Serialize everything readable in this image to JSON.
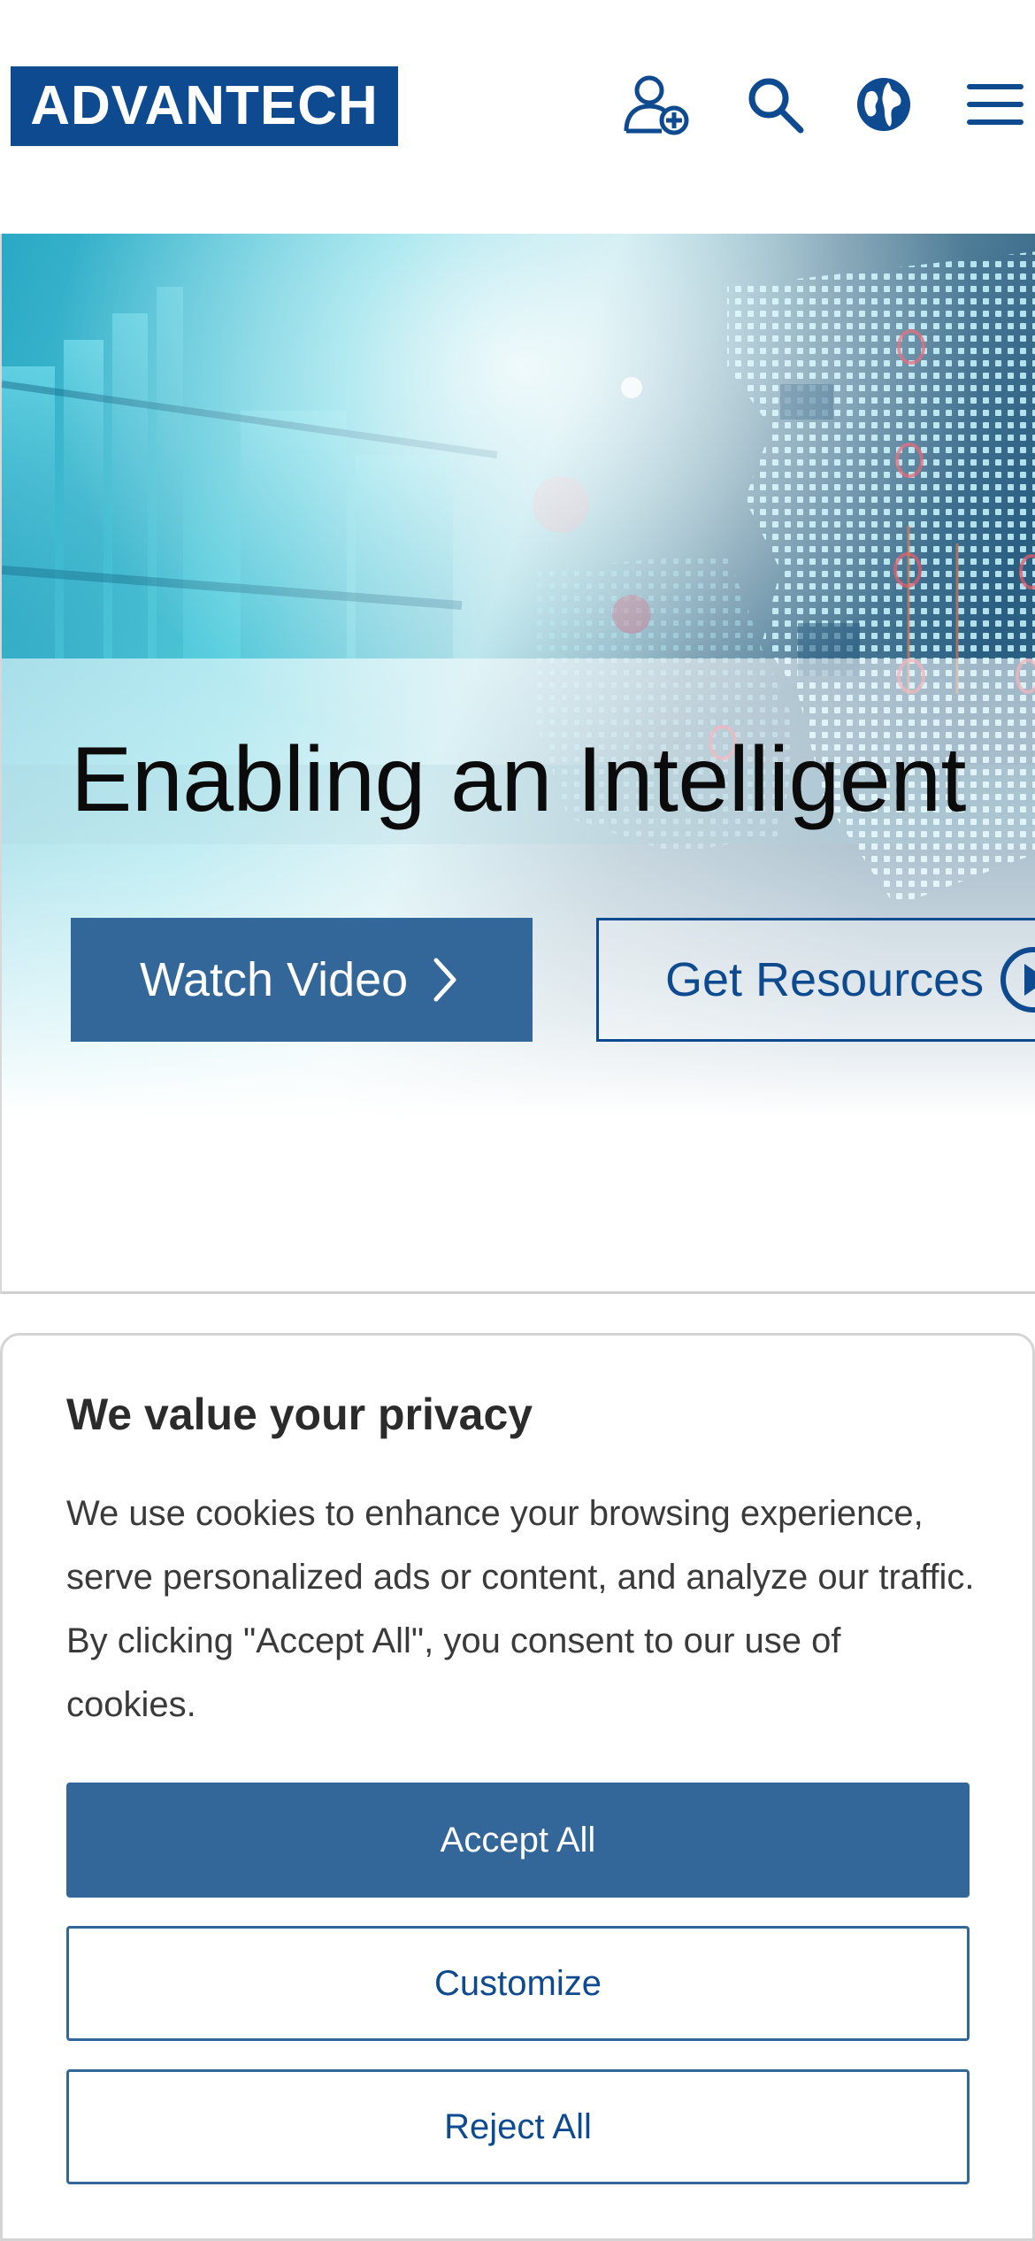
{
  "brand": {
    "logo_text": "ADVANTECH",
    "primary_color": "#0e4a8f",
    "button_color": "#336699"
  },
  "header": {
    "icons": [
      "user-add-icon",
      "search-icon",
      "globe-icon",
      "menu-icon"
    ]
  },
  "hero": {
    "title": "Enabling an Intelligent",
    "watch_video_label": "Watch Video",
    "get_resources_label": "Get Resources"
  },
  "cookie_banner": {
    "title": "We value your privacy",
    "text": "We use cookies to enhance your browsing experience, serve personalized ads or content, and analyze our traffic. By clicking \"Accept All\", you consent to our use of cookies.",
    "accept_label": "Accept All",
    "customize_label": "Customize",
    "reject_label": "Reject All"
  }
}
